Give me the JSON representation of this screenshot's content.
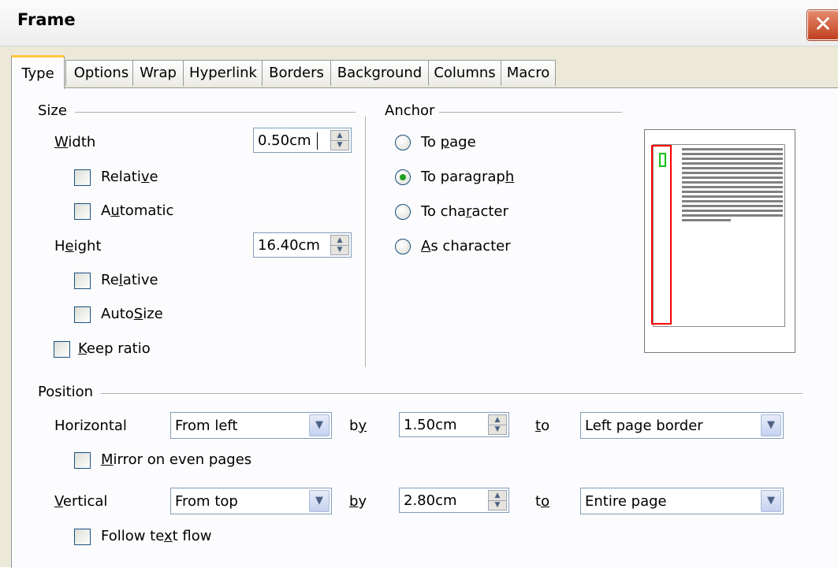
{
  "window": {
    "title": "Frame",
    "close_glyph": "✕"
  },
  "tabs": [
    {
      "label": "Type",
      "active": true
    },
    {
      "label": "Options",
      "active": false
    },
    {
      "label": "Wrap",
      "active": false
    },
    {
      "label": "Hyperlink",
      "active": false
    },
    {
      "label": "Borders",
      "active": false
    },
    {
      "label": "Background",
      "active": false
    },
    {
      "label": "Columns",
      "active": false
    },
    {
      "label": "Macro",
      "active": false
    }
  ],
  "size": {
    "group_label": "Size",
    "width": {
      "label_u": "W",
      "label_rest": "idth",
      "value": "0.50cm"
    },
    "width_relative": {
      "label_pre": "Relati",
      "label_u": "v",
      "label_post": "e",
      "checked": false
    },
    "automatic": {
      "label_pre": "A",
      "label_u": "u",
      "label_post": "tomatic",
      "checked": false
    },
    "height": {
      "label_pre": "H",
      "label_u": "e",
      "label_post": "ight",
      "value": "16.40cm"
    },
    "height_relative": {
      "label_pre": "Re",
      "label_u": "l",
      "label_post": "ative",
      "checked": false
    },
    "autosize": {
      "label_pre": "Auto",
      "label_u": "S",
      "label_post": "ize",
      "checked": false
    },
    "keep_ratio": {
      "label_u": "K",
      "label_post": "eep ratio",
      "checked": false
    }
  },
  "anchor": {
    "group_label": "Anchor",
    "to_page": {
      "label_pre": "To ",
      "label_u": "p",
      "label_post": "age",
      "selected": false
    },
    "to_paragraph": {
      "label_pre": "To paragrap",
      "label_u": "h",
      "label_post": "",
      "selected": true
    },
    "to_character": {
      "label_pre": "To cha",
      "label_u": "r",
      "label_post": "acter",
      "selected": false
    },
    "as_character": {
      "label_pre": "",
      "label_u": "A",
      "label_post": "s character",
      "selected": false
    }
  },
  "position": {
    "group_label": "Position",
    "horizontal": {
      "label": "Horizontal",
      "mode": "From left",
      "by_label_pre": "b",
      "by_label_u": "y",
      "by_value": "1.50cm",
      "to_label_u": "t",
      "to_label_post": "o",
      "to_value": "Left page border"
    },
    "mirror": {
      "label_u": "M",
      "label_post": "irror on even pages",
      "checked": false
    },
    "vertical": {
      "label_u": "V",
      "label_post": "ertical",
      "mode": "From top",
      "by_label_u": "b",
      "by_label_post": "y",
      "by_value": "2.80cm",
      "to_label_pre": "t",
      "to_label_u": "o",
      "to_value": "Entire page"
    },
    "follow_text_flow": {
      "label_pre": "Follow te",
      "label_u": "x",
      "label_post": "t flow",
      "checked": false
    }
  },
  "colors": {
    "frame_outline": "#ff0000",
    "anchor_marker": "#12c012",
    "radio_selected": "#21a121",
    "active_tab_highlight": "#ffc83c"
  }
}
